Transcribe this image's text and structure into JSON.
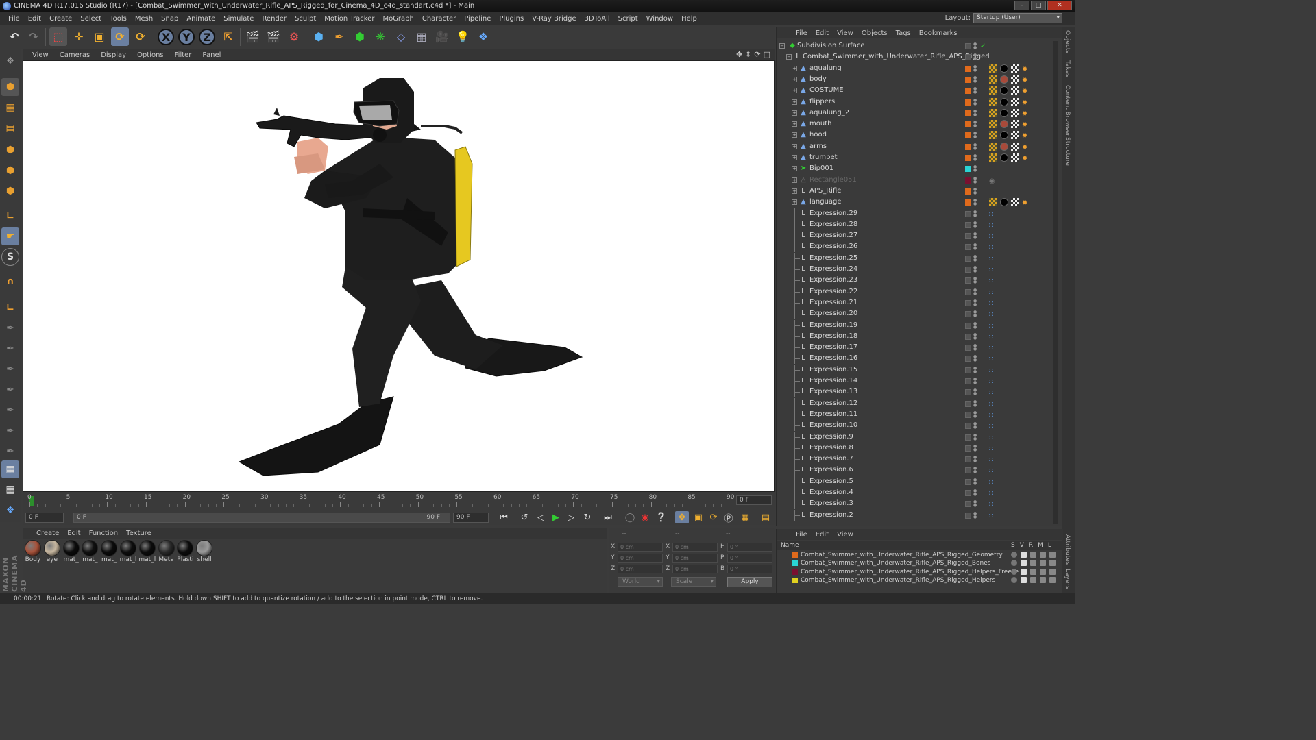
{
  "window": {
    "title": "CINEMA 4D R17.016 Studio (R17) - [Combat_Swimmer_with_Underwater_Rifle_APS_Rigged_for_Cinema_4D_c4d_standart.c4d *] - Main"
  },
  "menu": [
    "File",
    "Edit",
    "Create",
    "Select",
    "Tools",
    "Mesh",
    "Snap",
    "Animate",
    "Simulate",
    "Render",
    "Sculpt",
    "Motion Tracker",
    "MoGraph",
    "Character",
    "Pipeline",
    "Plugins",
    "V-Ray Bridge",
    "3DToAll",
    "Script",
    "Window",
    "Help"
  ],
  "layout": {
    "label": "Layout:",
    "value": "Startup (User)"
  },
  "toolbar": {
    "axis_x": "X",
    "axis_y": "Y",
    "axis_z": "Z"
  },
  "viewport_menu": [
    "View",
    "Cameras",
    "Display",
    "Options",
    "Filter",
    "Panel"
  ],
  "timeline": {
    "labels": [
      "0",
      "5",
      "10",
      "15",
      "20",
      "25",
      "30",
      "35",
      "40",
      "45",
      "50",
      "55",
      "60",
      "65",
      "70",
      "75",
      "80",
      "85",
      "90"
    ],
    "current_frame_field": "0 F"
  },
  "transport": {
    "start_field": "0 F",
    "range_start": "0 F",
    "range_end": "90 F",
    "end_field": "90 F"
  },
  "material_menu": [
    "Create",
    "Edit",
    "Function",
    "Texture"
  ],
  "materials": [
    {
      "name": "Body",
      "color": "#a8523a"
    },
    {
      "name": "eye",
      "color": "#c8b8a0"
    },
    {
      "name": "mat_",
      "color": "#0c0c0c"
    },
    {
      "name": "mat_",
      "color": "#101010"
    },
    {
      "name": "mat_",
      "color": "#0c0c0c"
    },
    {
      "name": "mat_l",
      "color": "#0e0e0e"
    },
    {
      "name": "mat_l",
      "color": "#0c0c0c"
    },
    {
      "name": "Meta",
      "color": "#2a2a2a"
    },
    {
      "name": "Plasti",
      "color": "#0c0c0c"
    },
    {
      "name": "shell",
      "color": "#9a9a9a"
    }
  ],
  "coordinates": {
    "header_a": "--",
    "header_b": "--",
    "header_c": "--",
    "rows": [
      {
        "l1": "X",
        "v1": "0 cm",
        "l2": "X",
        "v2": "0 cm",
        "l3": "H",
        "v3": "0 °"
      },
      {
        "l1": "Y",
        "v1": "0 cm",
        "l2": "Y",
        "v2": "0 cm",
        "l3": "P",
        "v3": "0 °"
      },
      {
        "l1": "Z",
        "v1": "0 cm",
        "l2": "Z",
        "v2": "0 cm",
        "l3": "B",
        "v3": "0 °"
      }
    ],
    "space": "World",
    "mode": "Scale",
    "apply": "Apply"
  },
  "status": {
    "time": "00:00:21",
    "message": "Rotate: Click and drag to rotate elements. Hold down SHIFT to add to quantize rotation / add to the selection in point mode, CTRL to remove."
  },
  "branding": "MAXON CINEMA 4D",
  "object_menu": [
    "File",
    "Edit",
    "View",
    "Objects",
    "Tags",
    "Bookmarks"
  ],
  "objects": [
    {
      "name": "Subdivision Surface",
      "type": "subdiv",
      "layer": "",
      "check": true
    },
    {
      "name": "Combat_Swimmer_with_Underwater_Rifle_APS_Rigged",
      "type": "null",
      "layer": ""
    },
    {
      "name": "aqualung",
      "type": "bone",
      "layer": "#e06a1c"
    },
    {
      "name": "body",
      "type": "bone",
      "layer": "#e06a1c"
    },
    {
      "name": "COSTUME",
      "type": "bone",
      "layer": "#e06a1c"
    },
    {
      "name": "flippers",
      "type": "bone",
      "layer": "#e06a1c"
    },
    {
      "name": "aqualung_2",
      "type": "bone",
      "layer": "#e06a1c"
    },
    {
      "name": "mouth",
      "type": "bone",
      "layer": "#e06a1c"
    },
    {
      "name": "hood",
      "type": "bone",
      "layer": "#e06a1c"
    },
    {
      "name": "arms",
      "type": "bone",
      "layer": "#e06a1c"
    },
    {
      "name": "trumpet",
      "type": "bone",
      "layer": "#e06a1c"
    },
    {
      "name": "Bip001",
      "type": "biped",
      "layer": "#2ad4d4"
    },
    {
      "name": "Rectangle051",
      "type": "spline",
      "layer": "#7a1030",
      "dim": true
    },
    {
      "name": "APS_Rifle",
      "type": "null",
      "layer": "#e06a1c"
    },
    {
      "name": "language",
      "type": "bone",
      "layer": "#e06a1c"
    },
    {
      "name": "Expression.29",
      "type": "null",
      "layer": ""
    },
    {
      "name": "Expression.28",
      "type": "null",
      "layer": ""
    },
    {
      "name": "Expression.27",
      "type": "null",
      "layer": ""
    },
    {
      "name": "Expression.26",
      "type": "null",
      "layer": ""
    },
    {
      "name": "Expression.25",
      "type": "null",
      "layer": ""
    },
    {
      "name": "Expression.24",
      "type": "null",
      "layer": ""
    },
    {
      "name": "Expression.23",
      "type": "null",
      "layer": ""
    },
    {
      "name": "Expression.22",
      "type": "null",
      "layer": ""
    },
    {
      "name": "Expression.21",
      "type": "null",
      "layer": ""
    },
    {
      "name": "Expression.20",
      "type": "null",
      "layer": ""
    },
    {
      "name": "Expression.19",
      "type": "null",
      "layer": ""
    },
    {
      "name": "Expression.18",
      "type": "null",
      "layer": ""
    },
    {
      "name": "Expression.17",
      "type": "null",
      "layer": ""
    },
    {
      "name": "Expression.16",
      "type": "null",
      "layer": ""
    },
    {
      "name": "Expression.15",
      "type": "null",
      "layer": ""
    },
    {
      "name": "Expression.14",
      "type": "null",
      "layer": ""
    },
    {
      "name": "Expression.13",
      "type": "null",
      "layer": ""
    },
    {
      "name": "Expression.12",
      "type": "null",
      "layer": ""
    },
    {
      "name": "Expression.11",
      "type": "null",
      "layer": ""
    },
    {
      "name": "Expression.10",
      "type": "null",
      "layer": ""
    },
    {
      "name": "Expression.9",
      "type": "null",
      "layer": ""
    },
    {
      "name": "Expression.8",
      "type": "null",
      "layer": ""
    },
    {
      "name": "Expression.7",
      "type": "null",
      "layer": ""
    },
    {
      "name": "Expression.6",
      "type": "null",
      "layer": ""
    },
    {
      "name": "Expression.5",
      "type": "null",
      "layer": ""
    },
    {
      "name": "Expression.4",
      "type": "null",
      "layer": ""
    },
    {
      "name": "Expression.3",
      "type": "null",
      "layer": ""
    },
    {
      "name": "Expression.2",
      "type": "null",
      "layer": ""
    }
  ],
  "right_tabs": [
    "Objects",
    "Takes",
    "Content Browser",
    "Structure",
    "Attributes",
    "Layers"
  ],
  "layer_menu": [
    "File",
    "Edit",
    "View"
  ],
  "layer_headers": {
    "name": "Name",
    "flags": [
      "S",
      "V",
      "R",
      "M",
      "L"
    ]
  },
  "layers": [
    {
      "name": "Combat_Swimmer_with_Underwater_Rifle_APS_Rigged_Geometry",
      "color": "#e06a1c"
    },
    {
      "name": "Combat_Swimmer_with_Underwater_Rifle_APS_Rigged_Bones",
      "color": "#2ad4d4"
    },
    {
      "name": "Combat_Swimmer_with_Underwater_Rifle_APS_Rigged_Helpers_Freeze",
      "color": "#7a1030"
    },
    {
      "name": "Combat_Swimmer_with_Underwater_Rifle_APS_Rigged_Helpers",
      "color": "#e0d020"
    }
  ]
}
